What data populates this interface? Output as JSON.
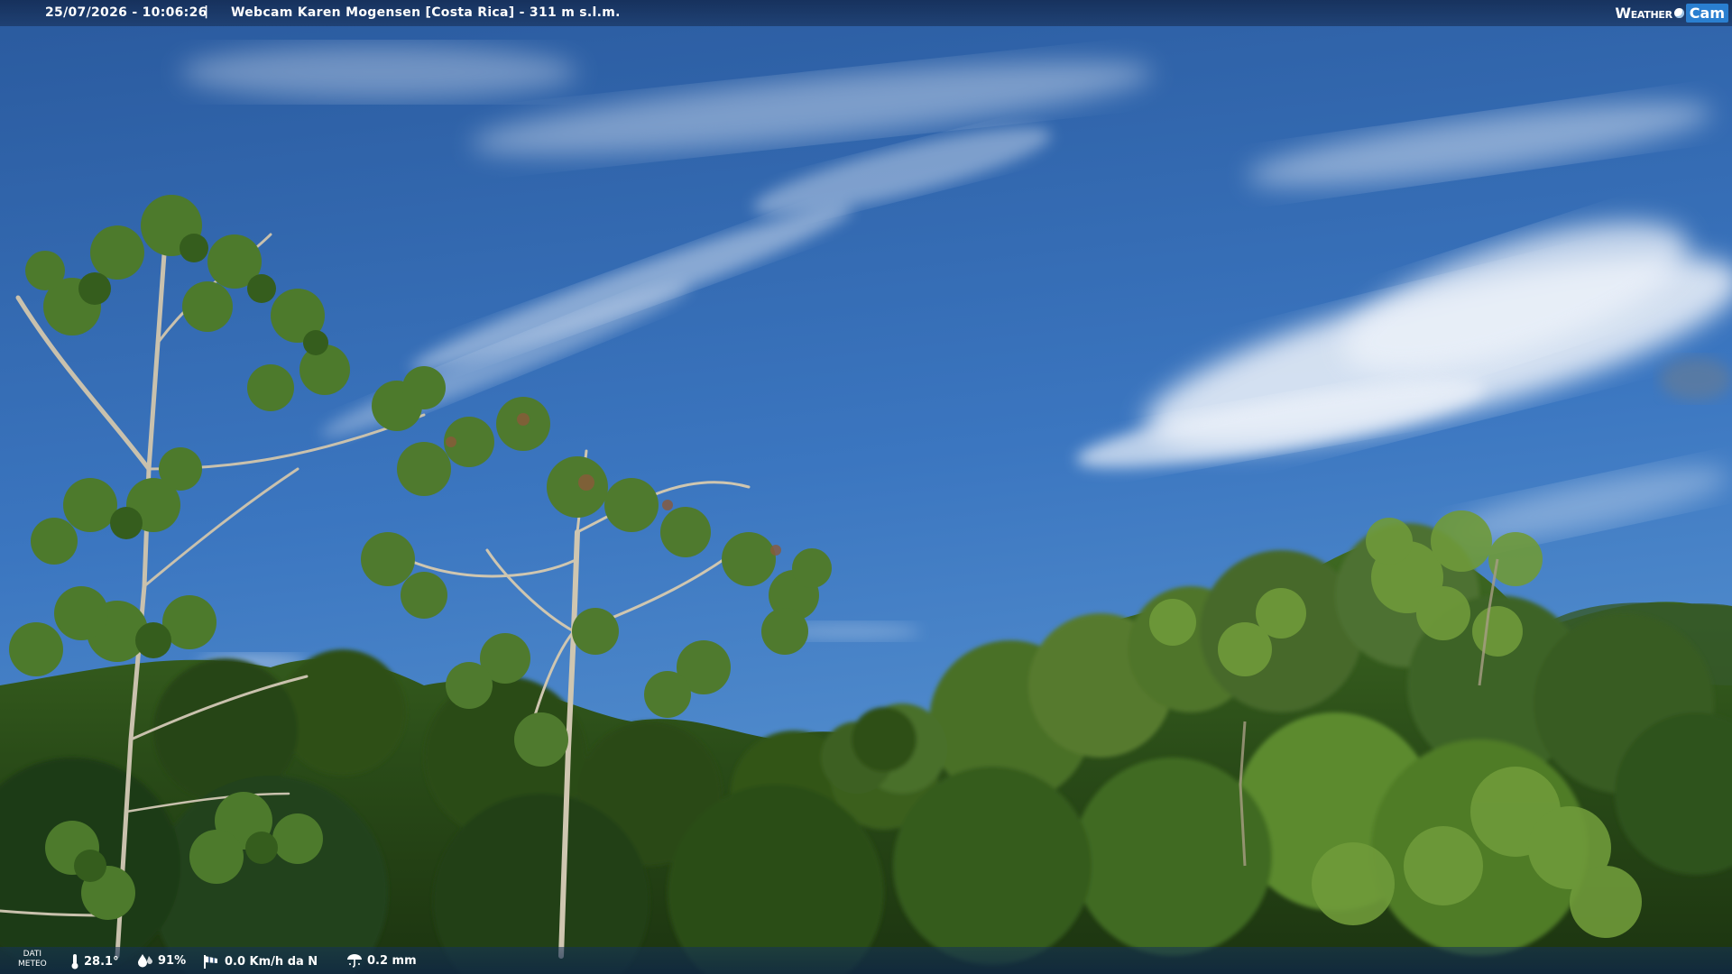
{
  "header": {
    "timestamp": "25/07/2026 - 10:06:26",
    "separator": "|",
    "title": "Webcam Karen Mogensen [Costa Rica] - 311 m s.l.m.",
    "logo_weather": "Weather",
    "logo_cam": "Cam"
  },
  "footer": {
    "label_line1": "DATI",
    "label_line2": "METEO",
    "temperature": "28.1°",
    "humidity": "91%",
    "wind": "0.0 Km/h da N",
    "rain": "0.2 mm"
  },
  "icons": {
    "temperature": "thermometer-icon",
    "humidity": "droplets-icon",
    "wind": "windsock-icon",
    "rain": "rain-gauge-icon"
  },
  "colors": {
    "sky_top": "#2a5a9e",
    "sky_bottom": "#4d8ccf",
    "foliage_dark": "#1f3a14",
    "foliage_light": "#5f8a34",
    "cloud": "#eef3fa"
  }
}
